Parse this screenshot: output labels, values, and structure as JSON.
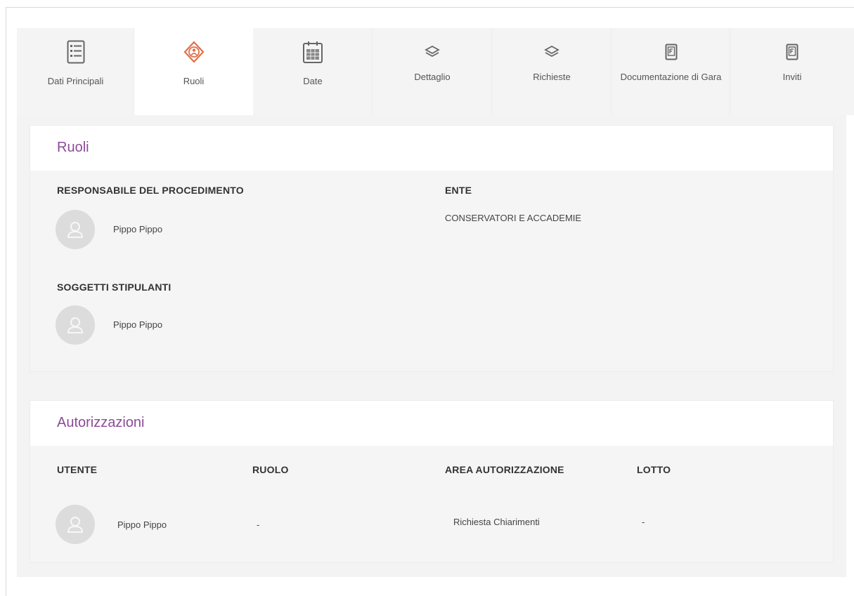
{
  "tabs": [
    {
      "label": "Dati Principali",
      "icon": "checklist-icon",
      "active": false
    },
    {
      "label": "Ruoli",
      "icon": "roles-icon",
      "active": true
    },
    {
      "label": "Date",
      "icon": "calendar-icon",
      "active": false
    },
    {
      "label": "Dettaglio",
      "icon": "layers-icon",
      "active": false
    },
    {
      "label": "Richieste",
      "icon": "layers-icon",
      "active": false
    },
    {
      "label": "Documentazione di Gara",
      "icon": "document-icon",
      "active": false
    },
    {
      "label": "Inviti",
      "icon": "document-icon",
      "active": false
    }
  ],
  "ruoli": {
    "title": "Ruoli",
    "responsabile_label": "RESPONSABILE DEL PROCEDIMENTO",
    "responsabile_name": "Pippo Pippo",
    "ente_label": "ENTE",
    "ente_value": "CONSERVATORI E ACCADEMIE",
    "soggetti_label": "SOGGETTI STIPULANTI",
    "soggetti_name": "Pippo Pippo"
  },
  "autorizzazioni": {
    "title": "Autorizzazioni",
    "columns": [
      "UTENTE",
      "RUOLO",
      "AREA AUTORIZZAZIONE",
      "LOTTO"
    ],
    "rows": [
      {
        "utente": "Pippo Pippo",
        "ruolo": "-",
        "area": "Richiesta Chiarimenti",
        "lotto": "-"
      }
    ]
  },
  "colors": {
    "accent_title": "#8c4a97",
    "active_icon": "#e0704a",
    "avatar_bg": "#dcdcdc"
  }
}
